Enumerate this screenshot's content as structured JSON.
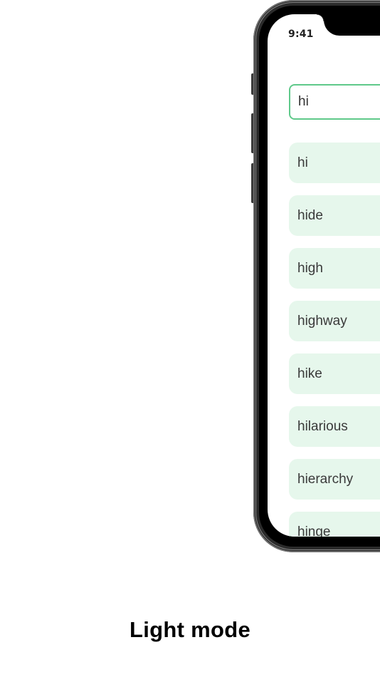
{
  "status_bar": {
    "time": "9:41"
  },
  "search": {
    "value": "hi"
  },
  "results": [
    {
      "label": "hi"
    },
    {
      "label": "hide"
    },
    {
      "label": "high"
    },
    {
      "label": "highway"
    },
    {
      "label": "hike"
    },
    {
      "label": "hilarious"
    },
    {
      "label": "hierarchy"
    },
    {
      "label": "hinge"
    }
  ],
  "caption": "Light mode",
  "colors": {
    "accent": "#5fc98a",
    "item_background": "#e6f7ec"
  }
}
